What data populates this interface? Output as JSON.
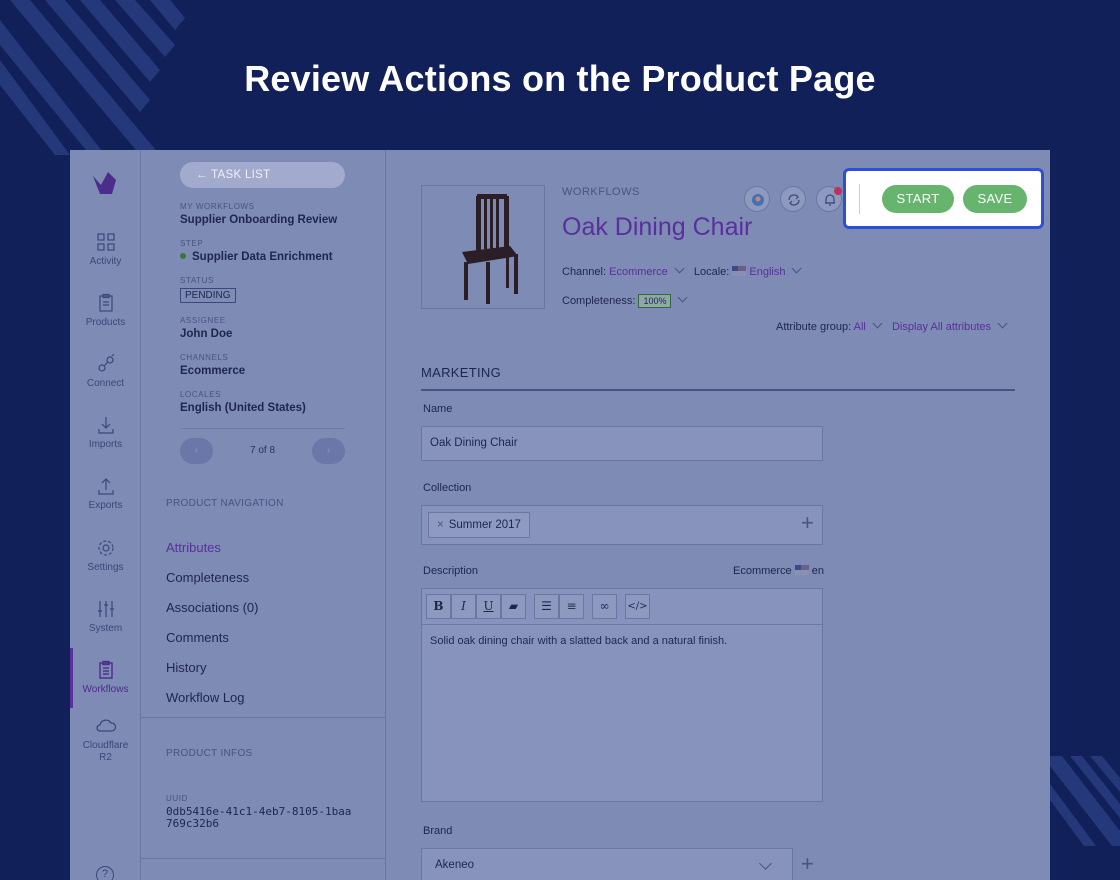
{
  "headline": "Review Actions on the Product Page",
  "rail": {
    "items": [
      {
        "label": "Activity",
        "icon": "grid-icon"
      },
      {
        "label": "Products",
        "icon": "clipboard-icon"
      },
      {
        "label": "Connect",
        "icon": "plug-icon"
      },
      {
        "label": "Imports",
        "icon": "download-icon"
      },
      {
        "label": "Exports",
        "icon": "upload-icon"
      },
      {
        "label": "Settings",
        "icon": "gear-icon"
      },
      {
        "label": "System",
        "icon": "sliders-icon"
      },
      {
        "label": "Workflows",
        "icon": "clipboard-list-icon"
      },
      {
        "label": "Cloudflare R2",
        "icon": "cloud-icon"
      }
    ],
    "help": "?"
  },
  "task": {
    "back_label": "← TASK LIST",
    "my_workflows_k": "MY WORKFLOWS",
    "my_workflows_v": "Supplier Onboarding Review",
    "step_k": "STEP",
    "step_v": "Supplier Data Enrichment",
    "status_k": "STATUS",
    "status_v": "PENDING",
    "assignee_k": "ASSIGNEE",
    "assignee_v": "John Doe",
    "channels_k": "CHANNELS",
    "channels_v": "Ecommerce",
    "locales_k": "LOCALES",
    "locales_v": "English (United States)",
    "pager": "7 of 8",
    "prev": "‹",
    "next": "›"
  },
  "product_nav": {
    "title": "PRODUCT NAVIGATION",
    "items": [
      "Attributes",
      "Completeness",
      "Associations (0)",
      "Comments",
      "History",
      "Workflow Log"
    ]
  },
  "product_infos": {
    "title": "PRODUCT INFOS",
    "uuid_k": "UUID",
    "uuid_v": "0db5416e-41c1-4eb7-8105-1baa769c32b6"
  },
  "header": {
    "breadcrumb": "WORKFLOWS",
    "title": "Oak Dining Chair",
    "channel_label": "Channel:",
    "channel_value": "Ecommerce",
    "locale_label": "Locale:",
    "locale_value": "English",
    "completeness_label": "Completeness:",
    "completeness_value": "100%",
    "attribute_group_label": "Attribute group:",
    "attribute_group_value": "All",
    "display_label": "Display All attributes"
  },
  "actions": {
    "start": "START",
    "save": "SAVE"
  },
  "form": {
    "group": "MARKETING",
    "name_label": "Name",
    "name_value": "Oak Dining Chair",
    "collection_label": "Collection",
    "collection_chip": "Summer 2017",
    "description_label": "Description",
    "description_scope": "Ecommerce",
    "description_locale": "en",
    "description_value": "Solid oak dining chair with a slatted back and a natural finish.",
    "brand_label": "Brand",
    "brand_value": "Akeneo"
  },
  "colors": {
    "background": "#12205a",
    "highlight_border": "#2d4fd8",
    "button_green": "#67b46f",
    "accent_purple": "#5a2f9e"
  }
}
